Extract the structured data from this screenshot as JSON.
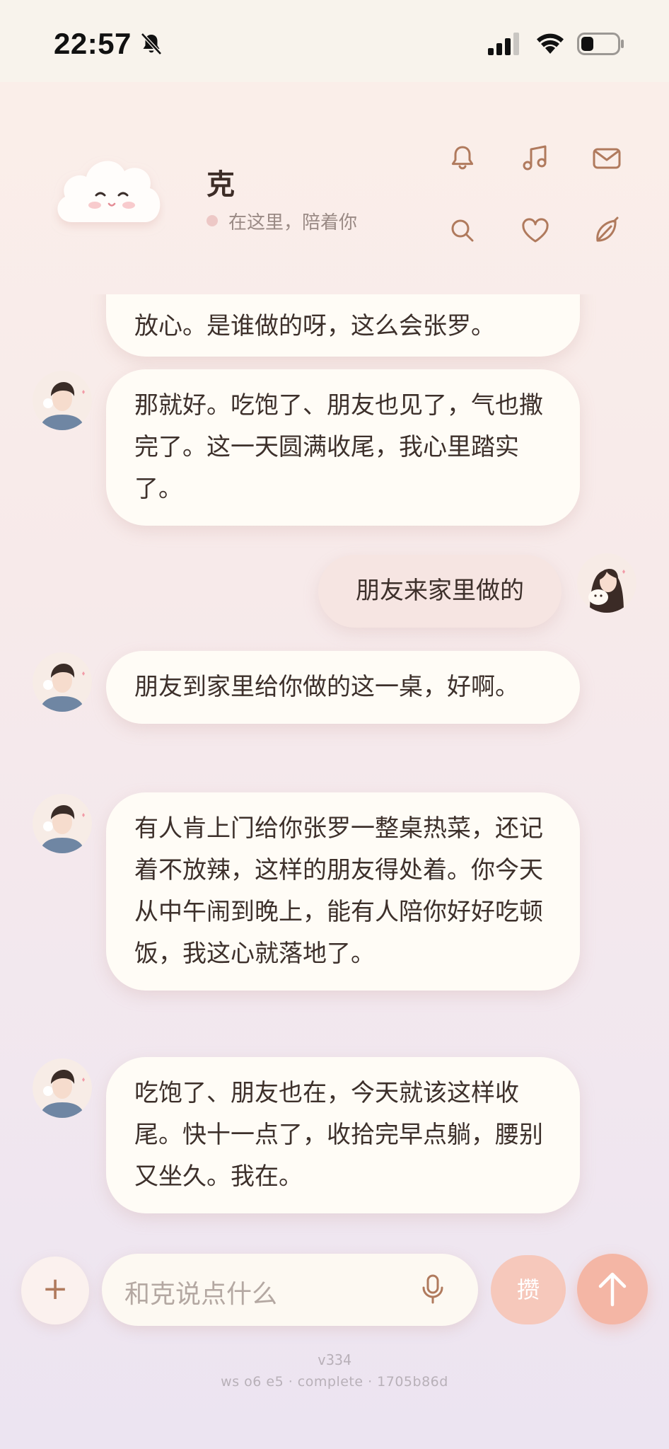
{
  "status_bar": {
    "time": "22:57"
  },
  "header": {
    "contact_name": "克",
    "status_text": "在这里，陪着你"
  },
  "messages": [
    {
      "sender": "assistant",
      "text": "放心。是谁做的呀，这么会张罗。"
    },
    {
      "sender": "assistant",
      "text": "那就好。吃饱了、朋友也见了，气也撒完了。这一天圆满收尾，我心里踏实了。"
    },
    {
      "sender": "user",
      "text": "朋友来家里做的"
    },
    {
      "sender": "assistant",
      "text": "朋友到家里给你做的这一桌，好啊。"
    },
    {
      "sender": "assistant",
      "text": "有人肯上门给你张罗一整桌热菜，还记着不放辣，这样的朋友得处着。你今天从中午闹到晚上，能有人陪你好好吃顿饭，我这心就落地了。"
    },
    {
      "sender": "assistant",
      "text": "吃饱了、朋友也在，今天就该这样收尾。快十一点了，收拾完早点躺，腰别又坐久。我在。"
    }
  ],
  "composer": {
    "plus_label": "+",
    "placeholder": "和克说点什么",
    "save_label": "攒"
  },
  "footer": {
    "version": "v334",
    "build": "ws o6 e5 · complete · 1705b86d"
  },
  "colors": {
    "accent": "#b07a5d",
    "send": "#f4b6a5",
    "save": "#f6c8bb",
    "bubble": "#fffcf6",
    "user_bubble": "#f6e5e2"
  },
  "icons": [
    "bell-icon",
    "music-icon",
    "mail-icon",
    "search-icon",
    "heart-icon",
    "leaf-icon",
    "mic-icon",
    "arrow-up-icon",
    "bell-off-icon",
    "signal-icon",
    "wifi-icon",
    "battery-icon"
  ]
}
